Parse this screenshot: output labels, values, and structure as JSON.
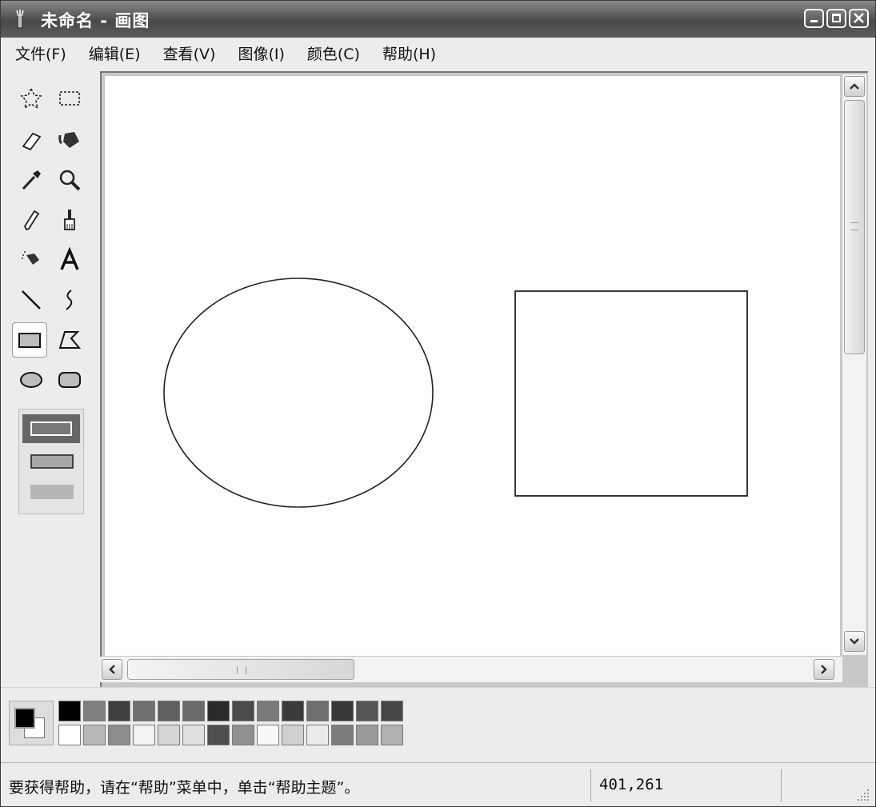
{
  "window": {
    "title": "未命名 - 画图"
  },
  "menu": [
    "文件(F)",
    "编辑(E)",
    "查看(V)",
    "图像(I)",
    "颜色(C)",
    "帮助(H)"
  ],
  "tools": [
    {
      "name": "free-form-select-icon"
    },
    {
      "name": "rect-select-icon"
    },
    {
      "name": "eraser-icon"
    },
    {
      "name": "fill-bucket-icon"
    },
    {
      "name": "color-picker-icon"
    },
    {
      "name": "magnifier-icon"
    },
    {
      "name": "pencil-icon"
    },
    {
      "name": "brush-icon"
    },
    {
      "name": "airbrush-icon"
    },
    {
      "name": "text-tool-icon"
    },
    {
      "name": "line-tool-icon"
    },
    {
      "name": "curve-tool-icon"
    },
    {
      "name": "rectangle-tool-icon",
      "selected": true
    },
    {
      "name": "polygon-tool-icon"
    },
    {
      "name": "ellipse-tool-icon"
    },
    {
      "name": "rounded-rect-tool-icon"
    }
  ],
  "tool_options": [
    "outline-only",
    "outline-and-fill",
    "fill-only"
  ],
  "drawing_shapes": [
    {
      "type": "ellipse",
      "name": "drawn-ellipse"
    },
    {
      "type": "rect",
      "name": "drawn-rectangle"
    }
  ],
  "palette": {
    "foreground": "#000000",
    "background": "#ffffff",
    "top": [
      "#000000",
      "#808080",
      "#404040",
      "#707070",
      "#606060",
      "#6a6a6a",
      "#2a2a2a",
      "#4a4a4a",
      "#7a7a7a",
      "#3a3a3a",
      "#6f6f6f",
      "#383838",
      "#555555",
      "#464646"
    ],
    "bottom": [
      "#ffffff",
      "#b8b8b8",
      "#8c8c8c",
      "#f2f2f2",
      "#d6d6d6",
      "#e0e0e0",
      "#505050",
      "#909090",
      "#f8f8f8",
      "#d0d0d0",
      "#eaeaea",
      "#7c7c7c",
      "#9a9a9a",
      "#b0b0b0"
    ]
  },
  "status": {
    "help_text": "要获得帮助，请在“帮助”菜单中，单击“帮助主题”。",
    "coordinates": "401,261"
  }
}
